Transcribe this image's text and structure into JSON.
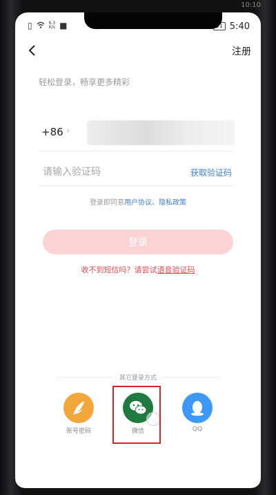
{
  "status_bar": {
    "network_speed_value": "6.3",
    "network_speed_unit": "K/s",
    "battery": "51",
    "time": "5:40",
    "hw_time": "10:10"
  },
  "header": {
    "register": "注册"
  },
  "slogan": "轻松登录，畅享更多精彩",
  "phone": {
    "country_code": "+86",
    "arrow": "›"
  },
  "code": {
    "placeholder": "请输入验证码",
    "get_code": "获取验证码"
  },
  "agreement": {
    "prefix": "登录即同意",
    "user_agreement": "用户协议",
    "separator": "、",
    "privacy_policy": "隐私政策"
  },
  "login_button": "登录",
  "sms_hint": {
    "prefix": "收不到短信吗？请尝试",
    "voice_code": "语音验证码"
  },
  "other_login": {
    "title": "其它登录方式",
    "methods": [
      {
        "label": "账号密码",
        "icon": "feather-icon"
      },
      {
        "label": "微信",
        "icon": "wechat-icon"
      },
      {
        "label": "QQ",
        "icon": "qq-penguin-icon"
      }
    ]
  },
  "colors": {
    "accent_blue": "#3d7fd8",
    "login_button": "#fcd3d5",
    "sms_red": "#e24b4f",
    "highlight_box": "#d9232b"
  }
}
